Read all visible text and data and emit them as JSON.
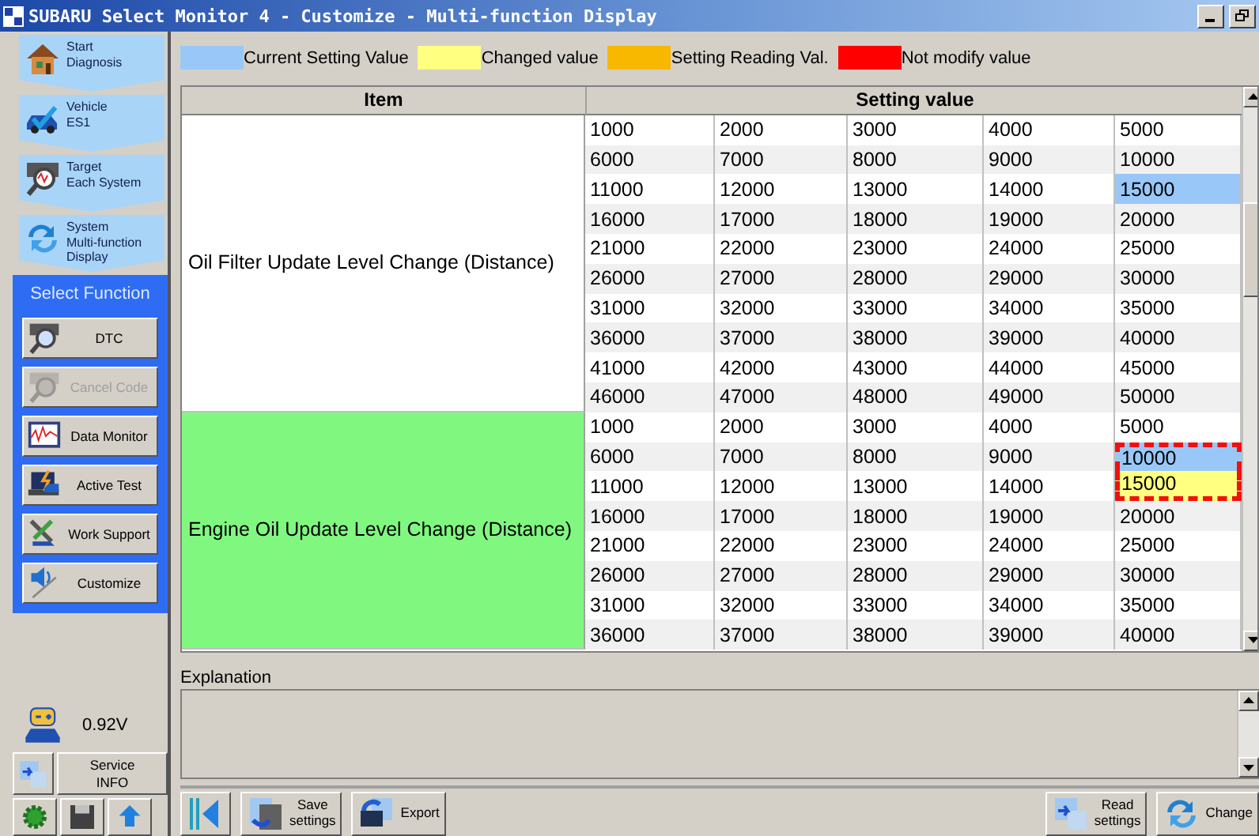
{
  "window": {
    "title": "SUBARU Select Monitor 4 - Customize - Multi-function Display"
  },
  "steps": [
    {
      "label": "Start\nDiagnosis"
    },
    {
      "label": "Vehicle\nES1"
    },
    {
      "label": "Target\nEach System"
    },
    {
      "label": "System\nMulti-function\nDisplay"
    }
  ],
  "function_panel": {
    "title": "Select Function",
    "buttons": [
      {
        "label": "DTC",
        "disabled": false
      },
      {
        "label": "Cancel Code",
        "disabled": true
      },
      {
        "label": "Data Monitor",
        "disabled": false
      },
      {
        "label": "Active Test",
        "disabled": false
      },
      {
        "label": "Work Support",
        "disabled": false
      },
      {
        "label": "Customize",
        "disabled": false
      }
    ]
  },
  "voltage": "0.92V",
  "service_button": "Service\nINFO",
  "legend": [
    {
      "label": "Current Setting Value",
      "color": "#99c8f8"
    },
    {
      "label": "Changed value",
      "color": "#ffff80"
    },
    {
      "label": "Setting Reading Val.",
      "color": "#f8b800"
    },
    {
      "label": "Not modify value",
      "color": "#ff0000"
    }
  ],
  "table": {
    "columns": [
      "Item",
      "Setting value"
    ],
    "groups": [
      {
        "item": "Oil Filter Update Level Change (Distance)",
        "selected": false,
        "rows": [
          [
            {
              "value": "1000",
              "current": false,
              "changed": false,
              "boxed": false
            },
            {
              "value": "2000",
              "current": false,
              "changed": false,
              "boxed": false
            },
            {
              "value": "3000",
              "current": false,
              "changed": false,
              "boxed": false
            },
            {
              "value": "4000",
              "current": false,
              "changed": false,
              "boxed": false
            },
            {
              "value": "5000",
              "current": false,
              "changed": false,
              "boxed": false
            }
          ],
          [
            {
              "value": "6000",
              "current": false,
              "changed": false,
              "boxed": false
            },
            {
              "value": "7000",
              "current": false,
              "changed": false,
              "boxed": false
            },
            {
              "value": "8000",
              "current": false,
              "changed": false,
              "boxed": false
            },
            {
              "value": "9000",
              "current": false,
              "changed": false,
              "boxed": false
            },
            {
              "value": "10000",
              "current": false,
              "changed": false,
              "boxed": false
            }
          ],
          [
            {
              "value": "11000",
              "current": false,
              "changed": false,
              "boxed": false
            },
            {
              "value": "12000",
              "current": false,
              "changed": false,
              "boxed": false
            },
            {
              "value": "13000",
              "current": false,
              "changed": false,
              "boxed": false
            },
            {
              "value": "14000",
              "current": false,
              "changed": false,
              "boxed": false
            },
            {
              "value": "15000",
              "current": true,
              "changed": false,
              "boxed": false
            }
          ],
          [
            {
              "value": "16000",
              "current": false,
              "changed": false,
              "boxed": false
            },
            {
              "value": "17000",
              "current": false,
              "changed": false,
              "boxed": false
            },
            {
              "value": "18000",
              "current": false,
              "changed": false,
              "boxed": false
            },
            {
              "value": "19000",
              "current": false,
              "changed": false,
              "boxed": false
            },
            {
              "value": "20000",
              "current": false,
              "changed": false,
              "boxed": false
            }
          ],
          [
            {
              "value": "21000",
              "current": false,
              "changed": false,
              "boxed": false
            },
            {
              "value": "22000",
              "current": false,
              "changed": false,
              "boxed": false
            },
            {
              "value": "23000",
              "current": false,
              "changed": false,
              "boxed": false
            },
            {
              "value": "24000",
              "current": false,
              "changed": false,
              "boxed": false
            },
            {
              "value": "25000",
              "current": false,
              "changed": false,
              "boxed": false
            }
          ],
          [
            {
              "value": "26000",
              "current": false,
              "changed": false,
              "boxed": false
            },
            {
              "value": "27000",
              "current": false,
              "changed": false,
              "boxed": false
            },
            {
              "value": "28000",
              "current": false,
              "changed": false,
              "boxed": false
            },
            {
              "value": "29000",
              "current": false,
              "changed": false,
              "boxed": false
            },
            {
              "value": "30000",
              "current": false,
              "changed": false,
              "boxed": false
            }
          ],
          [
            {
              "value": "31000",
              "current": false,
              "changed": false,
              "boxed": false
            },
            {
              "value": "32000",
              "current": false,
              "changed": false,
              "boxed": false
            },
            {
              "value": "33000",
              "current": false,
              "changed": false,
              "boxed": false
            },
            {
              "value": "34000",
              "current": false,
              "changed": false,
              "boxed": false
            },
            {
              "value": "35000",
              "current": false,
              "changed": false,
              "boxed": false
            }
          ],
          [
            {
              "value": "36000",
              "current": false,
              "changed": false,
              "boxed": false
            },
            {
              "value": "37000",
              "current": false,
              "changed": false,
              "boxed": false
            },
            {
              "value": "38000",
              "current": false,
              "changed": false,
              "boxed": false
            },
            {
              "value": "39000",
              "current": false,
              "changed": false,
              "boxed": false
            },
            {
              "value": "40000",
              "current": false,
              "changed": false,
              "boxed": false
            }
          ],
          [
            {
              "value": "41000",
              "current": false,
              "changed": false,
              "boxed": false
            },
            {
              "value": "42000",
              "current": false,
              "changed": false,
              "boxed": false
            },
            {
              "value": "43000",
              "current": false,
              "changed": false,
              "boxed": false
            },
            {
              "value": "44000",
              "current": false,
              "changed": false,
              "boxed": false
            },
            {
              "value": "45000",
              "current": false,
              "changed": false,
              "boxed": false
            }
          ],
          [
            {
              "value": "46000",
              "current": false,
              "changed": false,
              "boxed": false
            },
            {
              "value": "47000",
              "current": false,
              "changed": false,
              "boxed": false
            },
            {
              "value": "48000",
              "current": false,
              "changed": false,
              "boxed": false
            },
            {
              "value": "49000",
              "current": false,
              "changed": false,
              "boxed": false
            },
            {
              "value": "50000",
              "current": false,
              "changed": false,
              "boxed": false
            }
          ]
        ]
      },
      {
        "item": "Engine Oil Update Level Change (Distance)",
        "selected": true,
        "rows": [
          [
            {
              "value": "1000",
              "current": false,
              "changed": false,
              "boxed": false
            },
            {
              "value": "2000",
              "current": false,
              "changed": false,
              "boxed": false
            },
            {
              "value": "3000",
              "current": false,
              "changed": false,
              "boxed": false
            },
            {
              "value": "4000",
              "current": false,
              "changed": false,
              "boxed": false
            },
            {
              "value": "5000",
              "current": false,
              "changed": false,
              "boxed": false
            }
          ],
          [
            {
              "value": "6000",
              "current": false,
              "changed": false,
              "boxed": false
            },
            {
              "value": "7000",
              "current": false,
              "changed": false,
              "boxed": false
            },
            {
              "value": "8000",
              "current": false,
              "changed": false,
              "boxed": false
            },
            {
              "value": "9000",
              "current": false,
              "changed": false,
              "boxed": false
            },
            {
              "value": "10000",
              "current": true,
              "changed": false,
              "boxed": true
            }
          ],
          [
            {
              "value": "11000",
              "current": false,
              "changed": false,
              "boxed": false
            },
            {
              "value": "12000",
              "current": false,
              "changed": false,
              "boxed": false
            },
            {
              "value": "13000",
              "current": false,
              "changed": false,
              "boxed": false
            },
            {
              "value": "14000",
              "current": false,
              "changed": false,
              "boxed": false
            },
            {
              "value": "15000",
              "current": false,
              "changed": true,
              "boxed": true
            }
          ],
          [
            {
              "value": "16000",
              "current": false,
              "changed": false,
              "boxed": false
            },
            {
              "value": "17000",
              "current": false,
              "changed": false,
              "boxed": false
            },
            {
              "value": "18000",
              "current": false,
              "changed": false,
              "boxed": false
            },
            {
              "value": "19000",
              "current": false,
              "changed": false,
              "boxed": false
            },
            {
              "value": "20000",
              "current": false,
              "changed": false,
              "boxed": false
            }
          ],
          [
            {
              "value": "21000",
              "current": false,
              "changed": false,
              "boxed": false
            },
            {
              "value": "22000",
              "current": false,
              "changed": false,
              "boxed": false
            },
            {
              "value": "23000",
              "current": false,
              "changed": false,
              "boxed": false
            },
            {
              "value": "24000",
              "current": false,
              "changed": false,
              "boxed": false
            },
            {
              "value": "25000",
              "current": false,
              "changed": false,
              "boxed": false
            }
          ],
          [
            {
              "value": "26000",
              "current": false,
              "changed": false,
              "boxed": false
            },
            {
              "value": "27000",
              "current": false,
              "changed": false,
              "boxed": false
            },
            {
              "value": "28000",
              "current": false,
              "changed": false,
              "boxed": false
            },
            {
              "value": "29000",
              "current": false,
              "changed": false,
              "boxed": false
            },
            {
              "value": "30000",
              "current": false,
              "changed": false,
              "boxed": false
            }
          ],
          [
            {
              "value": "31000",
              "current": false,
              "changed": false,
              "boxed": false
            },
            {
              "value": "32000",
              "current": false,
              "changed": false,
              "boxed": false
            },
            {
              "value": "33000",
              "current": false,
              "changed": false,
              "boxed": false
            },
            {
              "value": "34000",
              "current": false,
              "changed": false,
              "boxed": false
            },
            {
              "value": "35000",
              "current": false,
              "changed": false,
              "boxed": false
            }
          ],
          [
            {
              "value": "36000",
              "current": false,
              "changed": false,
              "boxed": false
            },
            {
              "value": "37000",
              "current": false,
              "changed": false,
              "boxed": false
            },
            {
              "value": "38000",
              "current": false,
              "changed": false,
              "boxed": false
            },
            {
              "value": "39000",
              "current": false,
              "changed": false,
              "boxed": false
            },
            {
              "value": "40000",
              "current": false,
              "changed": false,
              "boxed": false
            }
          ]
        ]
      }
    ]
  },
  "explanation": {
    "label": "Explanation"
  },
  "toolbar": {
    "left": [
      {
        "kind": "back"
      },
      {
        "kind": "labeled",
        "label": "Save\nsettings"
      },
      {
        "kind": "labeled",
        "label": "Export"
      }
    ],
    "right": [
      {
        "kind": "labeled",
        "label": "Read\nsettings"
      },
      {
        "kind": "labeled",
        "label": "Change"
      }
    ]
  }
}
